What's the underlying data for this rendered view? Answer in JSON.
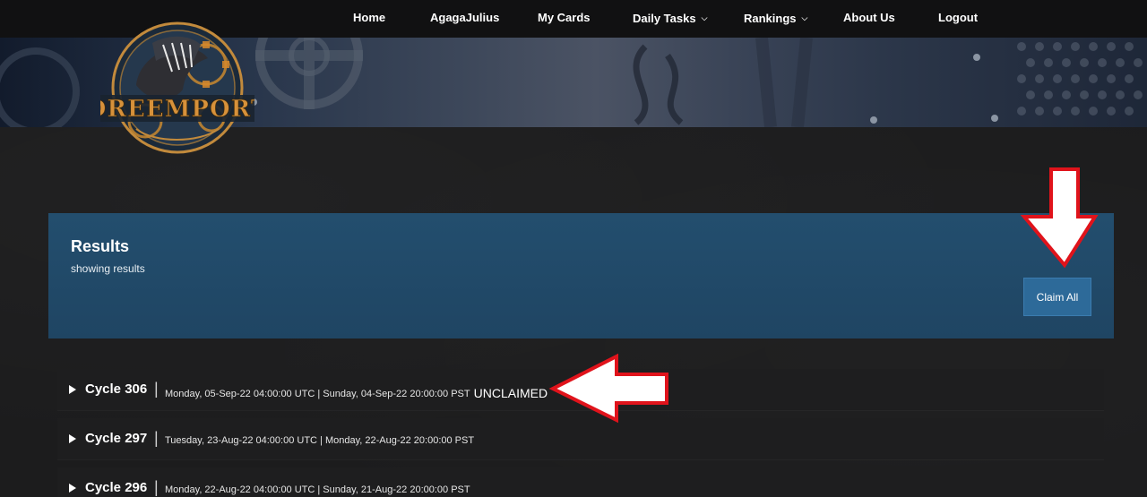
{
  "nav": {
    "items": [
      {
        "label": "Home"
      },
      {
        "label": "AgagaJulius"
      },
      {
        "label": "My Cards"
      },
      {
        "label": "Daily Tasks"
      },
      {
        "label": "Rankings"
      },
      {
        "label": "About Us"
      },
      {
        "label": "Logout"
      }
    ]
  },
  "logo": {
    "text": "DREEMPORT"
  },
  "results": {
    "title": "Results",
    "subtitle": "showing results",
    "claim_all_label": "Claim All"
  },
  "cycles": [
    {
      "name": "Cycle 306",
      "dates": "Monday, 05-Sep-22 04:00:00 UTC | Sunday, 04-Sep-22 20:00:00 PST",
      "status": "UNCLAIMED"
    },
    {
      "name": "Cycle 297",
      "dates": "Tuesday, 23-Aug-22 04:00:00 UTC | Monday, 22-Aug-22 20:00:00 PST",
      "status": ""
    },
    {
      "name": "Cycle 296",
      "dates": "Monday, 22-Aug-22 04:00:00 UTC | Sunday, 21-Aug-22 20:00:00 PST",
      "status": ""
    }
  ],
  "icons": {
    "submenu": "caret-down-icon",
    "expand": "triangle-right-icon",
    "annotation": "red-arrow-icon"
  },
  "colors": {
    "panel": "#234e6e",
    "button": "#2d6a99",
    "annotation": "#e0131b",
    "logo_gold": "#d7913a"
  }
}
